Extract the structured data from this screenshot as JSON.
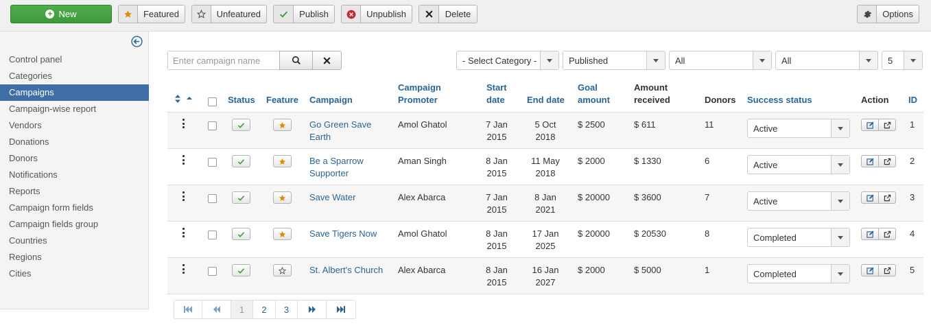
{
  "toolbar": {
    "new_label": "New",
    "featured_label": "Featured",
    "unfeatured_label": "Unfeatured",
    "publish_label": "Publish",
    "unpublish_label": "Unpublish",
    "delete_label": "Delete",
    "options_label": "Options"
  },
  "sidebar": {
    "items": [
      {
        "label": "Control panel"
      },
      {
        "label": "Categories"
      },
      {
        "label": "Campaigns",
        "active": true
      },
      {
        "label": "Campaign-wise report"
      },
      {
        "label": "Vendors"
      },
      {
        "label": "Donations"
      },
      {
        "label": "Donors"
      },
      {
        "label": "Notifications"
      },
      {
        "label": "Reports"
      },
      {
        "label": "Campaign form fields"
      },
      {
        "label": "Campaign fields group"
      },
      {
        "label": "Countries"
      },
      {
        "label": "Regions"
      },
      {
        "label": "Cities"
      }
    ]
  },
  "filters": {
    "search_placeholder": "Enter campaign name",
    "category": "- Select Category -",
    "published": "Published",
    "filter3": "All",
    "filter4": "All",
    "limit": "5"
  },
  "table": {
    "headers": {
      "status": "Status",
      "feature": "Feature",
      "campaign": "Campaign",
      "promoter_1": "Campaign",
      "promoter_2": "Promoter",
      "start_1": "Start",
      "start_2": "date",
      "end": "End date",
      "goal_1": "Goal",
      "goal_2": "amount",
      "amount_1": "Amount",
      "amount_2": "received",
      "donors": "Donors",
      "success": "Success status",
      "action": "Action",
      "id": "ID"
    },
    "rows": [
      {
        "campaign_1": "Go Green Save",
        "campaign_2": "Earth",
        "promoter": "Amol Ghatol",
        "start_1": "7 Jan",
        "start_2": "2015",
        "end_1": "5 Oct",
        "end_2": "2018",
        "goal": "$ 2500",
        "received": "$ 611",
        "donors": "11",
        "success": "Active",
        "id": "1",
        "featured": true
      },
      {
        "campaign_1": "Be a Sparrow",
        "campaign_2": "Supporter",
        "promoter": "Aman Singh",
        "start_1": "8 Jan",
        "start_2": "2015",
        "end_1": "11 May",
        "end_2": "2018",
        "goal": "$ 2000",
        "received": "$ 1330",
        "donors": "6",
        "success": "Active",
        "id": "2",
        "featured": true
      },
      {
        "campaign_1": "Save Water",
        "campaign_2": "",
        "promoter": "Alex Abarca",
        "start_1": "7 Jan",
        "start_2": "2015",
        "end_1": "8 Jan",
        "end_2": "2021",
        "goal": "$ 20000",
        "received": "$ 3600",
        "donors": "7",
        "success": "Active",
        "id": "3",
        "featured": true
      },
      {
        "campaign_1": "Save Tigers Now",
        "campaign_2": "",
        "promoter": "Amol Ghatol",
        "start_1": "8 Jan",
        "start_2": "2015",
        "end_1": "17 Jan",
        "end_2": "2025",
        "goal": "$ 20000",
        "received": "$ 20530",
        "donors": "8",
        "success": "Completed",
        "id": "4",
        "featured": true
      },
      {
        "campaign_1": "St. Albert's Church",
        "campaign_2": "",
        "promoter": "Alex Abarca",
        "start_1": "8 Jan",
        "start_2": "2015",
        "end_1": "16 Jan",
        "end_2": "2027",
        "goal": "$ 2000",
        "received": "$ 5000",
        "donors": "1",
        "success": "Completed",
        "id": "5",
        "featured": false
      }
    ]
  },
  "pagination": {
    "pages": [
      "1",
      "2",
      "3"
    ],
    "current": "1"
  },
  "colors": {
    "new_button": "#44a442",
    "active_menu": "#3f6ea6",
    "link": "#2a6496",
    "star": "#e08a00",
    "check": "#3e9b3c",
    "unpublish": "#c72b2b"
  }
}
